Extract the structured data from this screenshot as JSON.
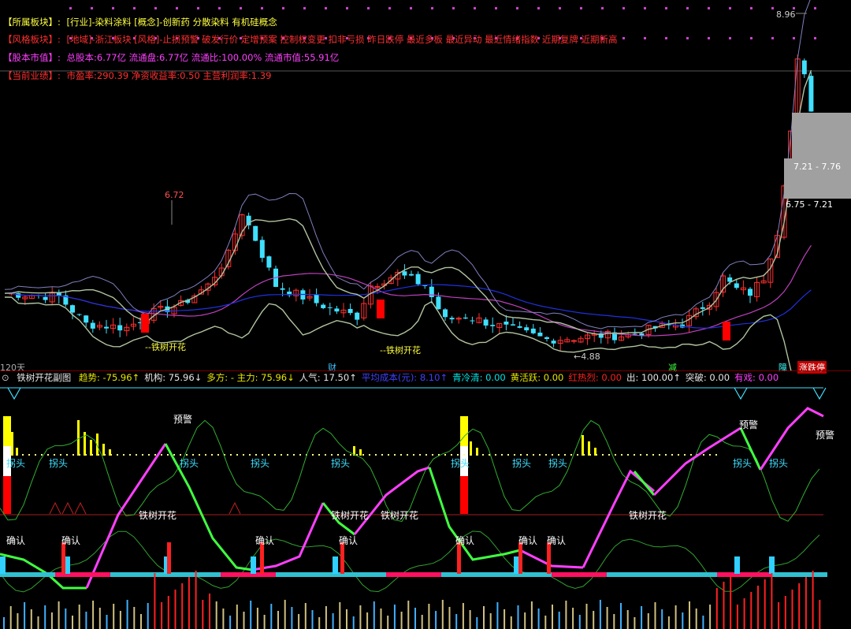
{
  "info": {
    "sector": {
      "label": "【所属板块】:",
      "value": "[行业]-染料涂料 [概念]-创新药 分散染料 有机硅概念"
    },
    "style": {
      "label": "【风格板块】:",
      "value": "[地域]-浙江板块 [风格]-止损预警 破发行价 定增预案 控制权变更 扣非亏损 昨日跌停 最近多板 最近异动 最近情绪指数 近期复牌 近期新高"
    },
    "capital": {
      "label": "【股本市值】:",
      "value": "总股本:6.77亿 流通盘:6.77亿 流通比:100.00% 流通市值:55.91亿"
    },
    "performance": {
      "label": "【当前业绩】:",
      "value": "市盈率:290.39 净资收益率:0.50 主营利润率:1.39"
    }
  },
  "main": {
    "period_label": "120天",
    "annotations": {
      "high_left": "6.72",
      "low_right": "4.88",
      "high_right": "8.96",
      "range_1": "7.21 - 7.76",
      "range_2": "6.75 - 7.21",
      "flower_1": "--铁树开花",
      "flower_2": "--铁树开花"
    },
    "tags": {
      "cai": "财",
      "jian": "减",
      "zhang": "障",
      "ztdt": "涨跌停"
    }
  },
  "sub": {
    "title": "铁树开花副图",
    "items": [
      {
        "text": "趋势: -75.96↑",
        "color": "#e6e600"
      },
      {
        "text": "机构: 75.96↓",
        "color": "#e6e6e6"
      },
      {
        "text": "多方: - 主力: 75.96↓",
        "color": "#e6e600"
      },
      {
        "text": "人气: 17.50↑",
        "color": "#e6e6e6"
      },
      {
        "text": "平均成本(元): 8.10↑",
        "color": "#4040ff"
      },
      {
        "text": "青冷清: 0.00",
        "color": "#00e6e6"
      },
      {
        "text": "黄活跃: 0.00",
        "color": "#e6e600"
      },
      {
        "text": "红热烈: 0.00",
        "color": "#ff2020"
      },
      {
        "text": "出: 100.00↑",
        "color": "#e6e6e6"
      },
      {
        "text": "突破: 0.00",
        "color": "#e6e6e6"
      },
      {
        "text": "有戏: 0.00",
        "color": "#ff40ff"
      }
    ],
    "labels": {
      "yujing": "预警",
      "guaitou": "拐头",
      "tieshu": "铁树开花",
      "queren": "确认"
    }
  },
  "colors": {
    "up": "#ff3030",
    "down": "#40e0ff",
    "ma_purple": "#c040c0",
    "ma_blue": "#2030e0",
    "band": "#b0c4a0",
    "band2": "#8080c0",
    "magenta": "#ff40ff",
    "green": "#40ff40"
  },
  "chart_data": {
    "type": "candlestick",
    "visible_range_label": "120天",
    "price_annotations": {
      "high_left": 6.72,
      "low": 4.88,
      "high_right": 8.96
    },
    "sub_indicator_values": {
      "趋势": -75.96,
      "机构": 75.96,
      "主力": 75.96,
      "人气": 17.5,
      "平均成本": 8.1,
      "青冷清": 0.0,
      "黄活跃": 0.0,
      "红热烈": 0.0,
      "出": 100.0,
      "突破": 0.0,
      "有戏": 0.0
    }
  }
}
